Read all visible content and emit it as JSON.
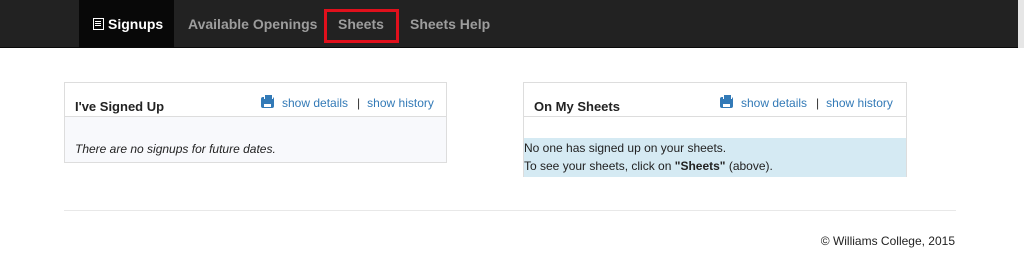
{
  "nav": {
    "signups": "Signups",
    "openings": "Available Openings",
    "sheets": "Sheets",
    "help": "Sheets Help"
  },
  "icons": {
    "nav_signups": "list-icon",
    "print": "print-icon"
  },
  "colors": {
    "navbar": "#222222",
    "link": "#337ab7",
    "highlight": "#e0101c",
    "info_bg": "#d5eaf3"
  },
  "left_panel": {
    "title": "I've Signed Up",
    "show_details": "show details",
    "separator": "|",
    "show_history": "show history",
    "empty_text": "There are no signups for future dates."
  },
  "right_panel": {
    "title": "On My Sheets",
    "show_details": "show details",
    "separator": "|",
    "show_history": "show history",
    "line1": "No one has signed up on your sheets.",
    "line2_pre": "To see your sheets, click on ",
    "line2_bold": "\"Sheets\"",
    "line2_post": " (above)."
  },
  "footer": {
    "copyright": "© Williams College, 2015"
  }
}
